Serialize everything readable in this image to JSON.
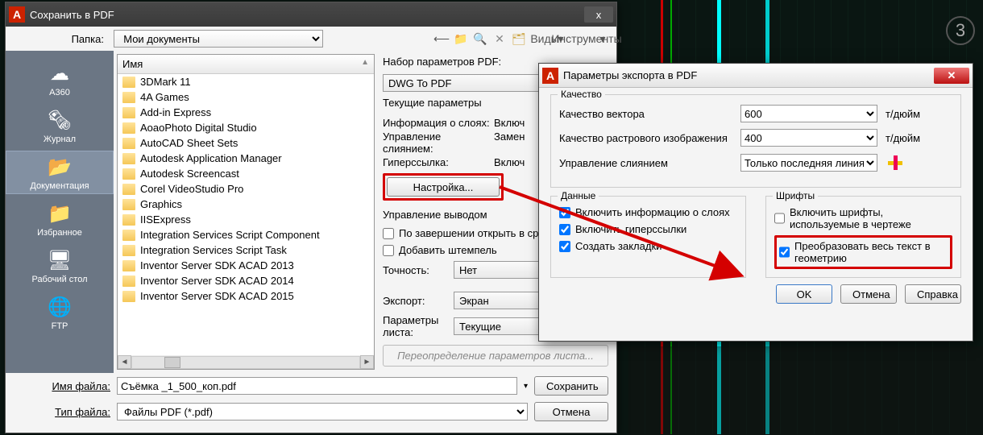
{
  "main": {
    "title": "Сохранить в PDF",
    "close": "x",
    "path_label": "Папка:",
    "path_value": "Мои документы",
    "views": "Виды",
    "tools": "Инструменты",
    "col_name": "Имя",
    "files": [
      "3DMark 11",
      "4A Games",
      "Add-in Express",
      "AoaoPhoto Digital Studio",
      "AutoCAD Sheet Sets",
      "Autodesk Application Manager",
      "Autodesk Screencast",
      "Corel VideoStudio Pro",
      "Graphics",
      "IISExpress",
      "Integration Services Script Component",
      "Integration Services Script Task",
      "Inventor Server SDK ACAD 2013",
      "Inventor Server SDK ACAD 2014",
      "Inventor Server SDK ACAD 2015"
    ],
    "sidebar": [
      {
        "label": "A360"
      },
      {
        "label": "Журнал"
      },
      {
        "label": "Документация"
      },
      {
        "label": "Избранное"
      },
      {
        "label": "Рабочий стол"
      },
      {
        "label": "FTP"
      }
    ],
    "pdf_params_label": "Набор параметров PDF:",
    "pdf_preset": "DWG To PDF",
    "current_params": "Текущие параметры",
    "info_layers": {
      "k": "Информация о слоях:",
      "v": "Включ"
    },
    "merge_ctrl": {
      "k": "Управление слиянием:",
      "v": "Замен"
    },
    "hyperlink": {
      "k": "Гиперссылка:",
      "v": "Включ"
    },
    "settings_btn": "Настройка...",
    "output_ctrl": "Управление выводом",
    "open_after": "По завершении открыть в сред",
    "add_stamp": "Добавить штемпель",
    "precision": {
      "k": "Точность:",
      "v": "Нет"
    },
    "export": {
      "k": "Экспорт:",
      "v": "Экран"
    },
    "sheet_params": {
      "k": "Параметры листа:",
      "v": "Текущие"
    },
    "override": "Переопределение параметров листа...",
    "filename_label": "Имя файла:",
    "filename": "Съёмка _1_500_коп.pdf",
    "filetype_label": "Тип файла:",
    "filetype": "Файлы PDF (*.pdf)",
    "save": "Сохранить",
    "cancel": "Отмена"
  },
  "sub": {
    "title": "Параметры экспорта в PDF",
    "quality": "Качество",
    "vector_q": "Качество вектора",
    "vector_v": "600",
    "raster_q": "Качество растрового изображения",
    "raster_v": "400",
    "dpi": "т/дюйм",
    "merge": "Управление слиянием",
    "merge_v": "Только последняя линия",
    "data": "Данные",
    "fonts": "Шрифты",
    "incl_layers": "Включить информацию о слоях",
    "incl_links": "Включить гиперссылки",
    "bookmarks": "Создать закладки",
    "incl_fonts": "Включить шрифты, используемые в чертеже",
    "convert_text": "Преобразовать весь текст в геометрию",
    "ok": "OK",
    "cancel": "Отмена",
    "help": "Справка"
  },
  "badge": "3"
}
